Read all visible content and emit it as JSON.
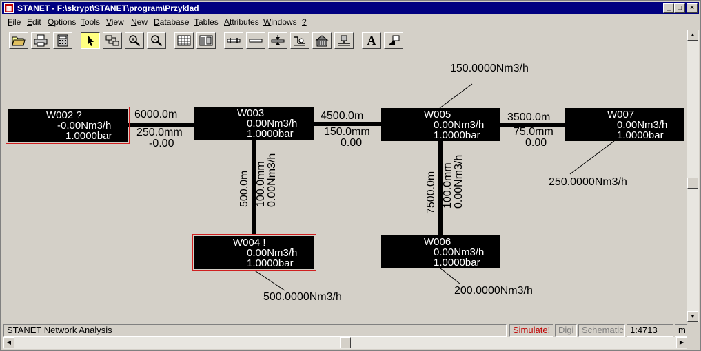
{
  "window": {
    "title": "STANET - F:\\skrypt\\STANET\\program\\Przyklad",
    "app_icon": "stanet-app-icon",
    "controls": {
      "minimize": "_",
      "maximize": "□",
      "close": "×"
    }
  },
  "menu": [
    {
      "label": "File",
      "u": "F",
      "rest": "ile"
    },
    {
      "label": "Edit",
      "u": "E",
      "rest": "dit"
    },
    {
      "label": "Options",
      "u": "O",
      "rest": "ptions"
    },
    {
      "label": "Tools",
      "u": "T",
      "rest": "ools"
    },
    {
      "label": "View",
      "u": "V",
      "rest": "iew"
    },
    {
      "label": "New",
      "u": "N",
      "rest": "ew"
    },
    {
      "label": "Database",
      "u": "D",
      "rest": "atabase"
    },
    {
      "label": "Tables",
      "u": "T",
      "rest": "ables"
    },
    {
      "label": "Attributes",
      "u": "A",
      "rest": "ttributes"
    },
    {
      "label": "Windows",
      "u": "W",
      "rest": "indows"
    },
    {
      "label": "?",
      "u": "?",
      "rest": ""
    }
  ],
  "toolbar": {
    "text_tool_label": "A",
    "buttons": [
      "open-folder-icon",
      "print-icon",
      "calculator-icon",
      "arrow-pointer-icon",
      "network-select-icon",
      "zoom-in-icon",
      "zoom-out-icon",
      "table-icon",
      "form-icon",
      "pipe-icon",
      "line-icon",
      "valve-icon",
      "pump-icon",
      "station-icon",
      "consumer-icon",
      "text-icon",
      "fill-icon"
    ]
  },
  "network": {
    "nodes": {
      "w002": {
        "name": "W002 ?",
        "flow": "-0.00Nm3/h",
        "pressure": "1.0000bar"
      },
      "w003": {
        "name": "W003",
        "flow": "0.00Nm3/h",
        "pressure": "1.0000bar"
      },
      "w004": {
        "name": "W004 !",
        "flow": "0.00Nm3/h",
        "pressure": "1.0000bar"
      },
      "w005": {
        "name": "W005",
        "flow": "0.00Nm3/h",
        "pressure": "1.0000bar"
      },
      "w006": {
        "name": "W006",
        "flow": "0.00Nm3/h",
        "pressure": "1.0000bar"
      },
      "w007": {
        "name": "W007",
        "flow": "0.00Nm3/h",
        "pressure": "1.0000bar"
      }
    },
    "pipes": {
      "w002_w003": {
        "length": "6000.0m",
        "diameter": "250.0mm",
        "flow": "-0.00"
      },
      "w003_w005": {
        "length": "4500.0m",
        "diameter": "150.0mm",
        "flow": "0.00"
      },
      "w005_w007": {
        "length": "3500.0m",
        "diameter": "75.0mm",
        "flow": "0.00"
      },
      "w003_w004": {
        "length": "500.0m",
        "diameter": "100.0mm",
        "flow": "0.00Nm3/h"
      },
      "w005_w006": {
        "length": "7500.0m",
        "diameter": "100.0mm",
        "flow": "0.00Nm3/h"
      }
    },
    "consumers": {
      "w005": "150.0000Nm3/h",
      "w007": "250.0000Nm3/h",
      "w004": "500.0000Nm3/h",
      "w006": "200.0000Nm3/h"
    }
  },
  "status": {
    "app": "STANET Network Analysis",
    "simulate": "Simulate!",
    "digi": "Digi",
    "schematic": "Schematic",
    "scale": "1:4713",
    "unit": "m",
    "colors": {
      "simulate": "#c00000",
      "disabled": "#808080"
    }
  }
}
